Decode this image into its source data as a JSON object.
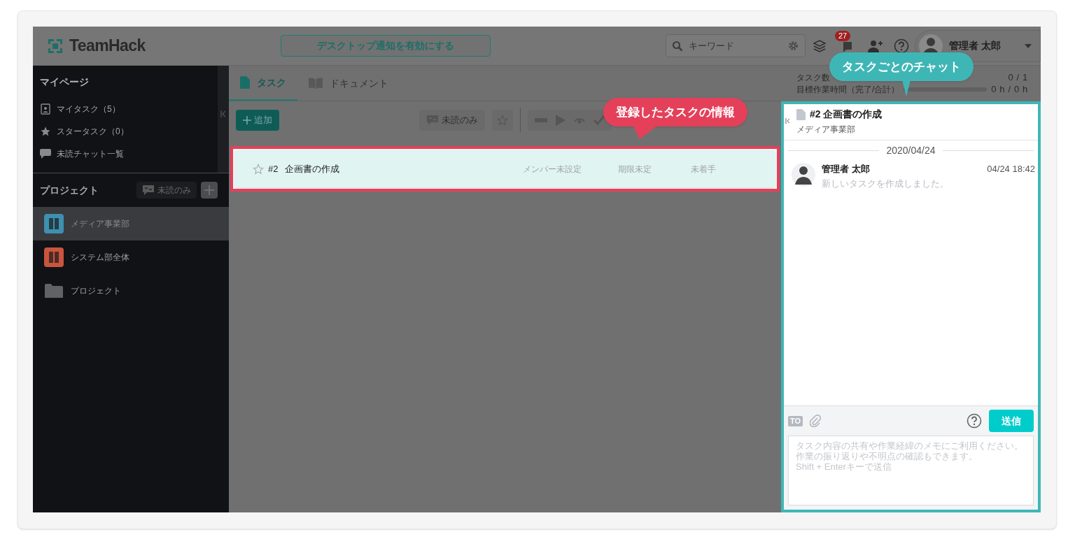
{
  "header": {
    "logo": "TeamHack",
    "notify_button": "デスクトップ通知を有効にする",
    "search": {
      "placeholder": "キーワード"
    },
    "notification_count": "27",
    "user": "管理者 太郎"
  },
  "sidebar": {
    "mypage": {
      "title": "マイページ",
      "items": [
        {
          "label": "マイタスク（5）",
          "kind": "person"
        },
        {
          "label": "スタータスク（0）",
          "kind": "star"
        },
        {
          "label": "未読チャット一覧",
          "kind": "chat"
        }
      ]
    },
    "projects": {
      "title": "プロジェクト",
      "unread_filter": "未読のみ",
      "items": [
        {
          "label": "メディア事業部",
          "kind": "board",
          "color": "#3f8fb0",
          "selected": true
        },
        {
          "label": "システム部全体",
          "kind": "board",
          "color": "#c9553f",
          "selected": false
        },
        {
          "label": "プロジェクト",
          "kind": "folder",
          "selected": false
        }
      ]
    }
  },
  "tabs": [
    {
      "label": "タスク",
      "selected": true
    },
    {
      "label": "ドキュメント",
      "selected": false
    }
  ],
  "toolbar": {
    "add_button": "追加",
    "unread_filter": "未読のみ"
  },
  "tasks": [
    {
      "starred": false,
      "number": "#2",
      "title": "企画書の作成",
      "member": "メンバー未設定",
      "due": "期限未定",
      "status": "未着手"
    }
  ],
  "stats": [
    {
      "label": "タスク数",
      "value": "0 / 1"
    },
    {
      "label": "目標作業時間（完了/合計）",
      "value": "0 h / 0 h",
      "level": 0
    }
  ],
  "chat": {
    "task_number": "#2",
    "task_title": "企画書の作成",
    "project": "メディア事業部",
    "date": "2020/04/24",
    "messages": [
      {
        "author": "管理者 太郎",
        "time": "04/24 18:42",
        "text": "新しいタスクを作成しました。"
      }
    ],
    "to_label": "TO",
    "send_button": "送信",
    "input": {
      "placeholder": "タスク内容の共有や作業経緯のメモにご利用ください。作業の振り返りや不明点の確認もできます。\nShift + Enterキーで送信"
    }
  },
  "callouts": [
    {
      "text": "登録したタスクの情報",
      "color": "#e4405a"
    },
    {
      "text": "タスクごとのチャット",
      "color": "#3fb6b6"
    }
  ]
}
